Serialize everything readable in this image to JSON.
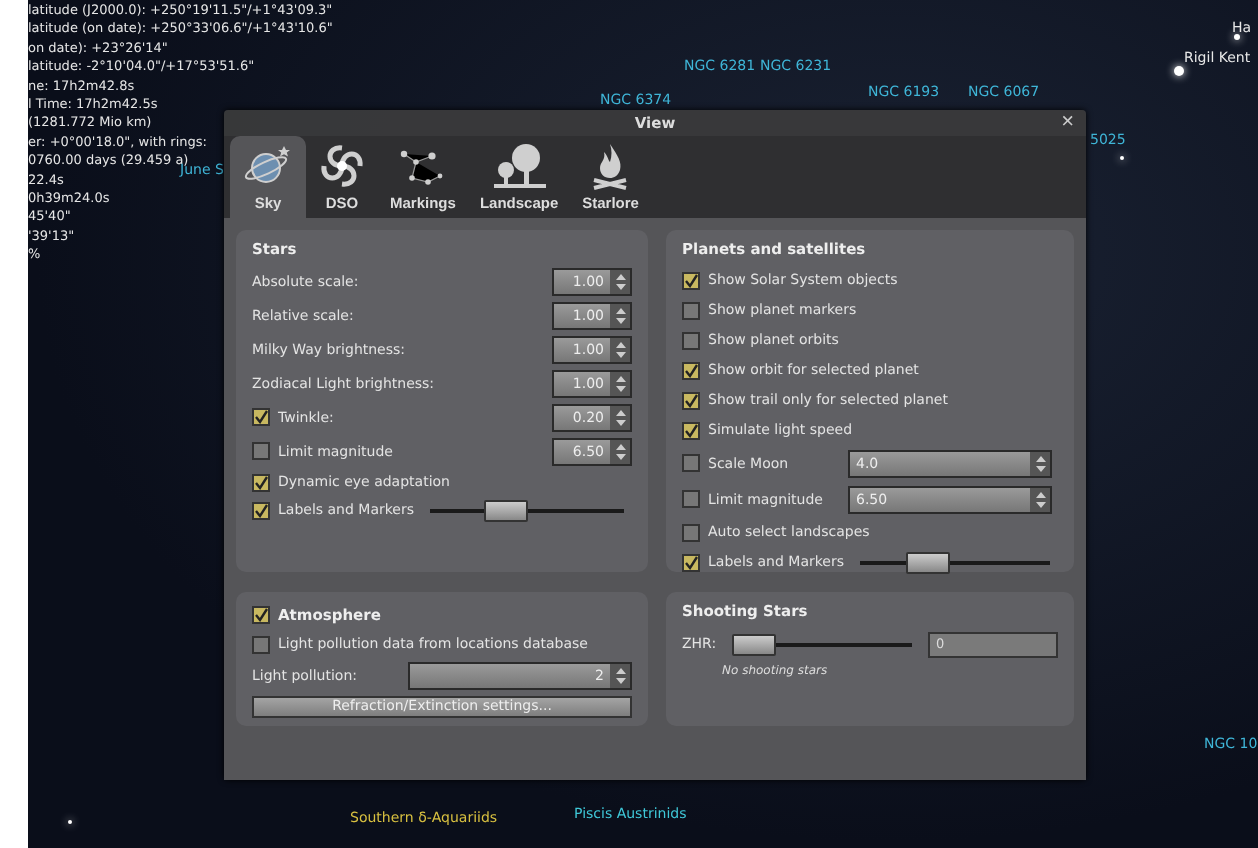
{
  "sky": {
    "info_lines": [
      "latitude (J2000.0): +250°19'11.5\"/+1°43'09.3\"",
      "latitude (on date): +250°33'06.6\"/+1°43'10.6\"",
      "on date): +23°26'14\"",
      "latitude: -2°10'04.0\"/+17°53'51.6\"",
      "ne: 17h2m42.8s",
      "l Time: 17h2m42.5s",
      "(1281.772 Mio km)",
      "er: +0°00'18.0\", with rings:",
      "0760.00 days (29.459 a)",
      "22.4s",
      "0h39m24.0s",
      "45'40\"",
      "'39'13\"",
      "%"
    ],
    "labels": [
      {
        "text": "NGC 6374",
        "color": "#3fb6d8"
      },
      {
        "text": "NGC 6281",
        "color": "#3fb6d8"
      },
      {
        "text": "NGC 6231",
        "color": "#3fb6d8"
      },
      {
        "text": "NGC 6193",
        "color": "#3fb6d8"
      },
      {
        "text": "NGC 6067",
        "color": "#3fb6d8"
      },
      {
        "text": "5025",
        "color": "#3fb6d8"
      },
      {
        "text": "Ha",
        "color": "#e8e8e8"
      },
      {
        "text": "Rigil Kent",
        "color": "#e8e8e8"
      },
      {
        "text": "June S",
        "color": "#3fb6d8"
      },
      {
        "text": "Southern δ-Aquariids",
        "color": "#d8c040"
      },
      {
        "text": "Piscis Austrinids",
        "color": "#3fc8d8"
      },
      {
        "text": "NGC 10",
        "color": "#3fb6d8"
      }
    ]
  },
  "window": {
    "title": "View",
    "close": "×"
  },
  "tabs": [
    {
      "label": "Sky",
      "selected": true
    },
    {
      "label": "DSO",
      "selected": false
    },
    {
      "label": "Markings",
      "selected": false
    },
    {
      "label": "Landscape",
      "selected": false
    },
    {
      "label": "Starlore",
      "selected": false
    }
  ],
  "stars": {
    "title": "Stars",
    "rows": [
      {
        "kind": "spin",
        "label": "Absolute scale:",
        "value": "1.00"
      },
      {
        "kind": "spin",
        "label": "Relative scale:",
        "value": "1.00"
      },
      {
        "kind": "spin",
        "label": "Milky Way brightness:",
        "value": "1.00"
      },
      {
        "kind": "spin",
        "label": "Zodiacal Light brightness:",
        "value": "1.00"
      },
      {
        "kind": "check-spin",
        "label": "Twinkle:",
        "checked": true,
        "value": "0.20"
      },
      {
        "kind": "check-spin",
        "label": "Limit magnitude",
        "checked": false,
        "value": "6.50"
      },
      {
        "kind": "check",
        "label": "Dynamic eye adaptation",
        "checked": true
      },
      {
        "kind": "check-slider",
        "label": "Labels and Markers",
        "checked": true,
        "level": 0.35
      }
    ]
  },
  "planets": {
    "title": "Planets and satellites",
    "rows": [
      {
        "kind": "check",
        "label": "Show Solar System objects",
        "checked": true
      },
      {
        "kind": "check",
        "label": "Show planet markers",
        "checked": false
      },
      {
        "kind": "check",
        "label": "Show planet orbits",
        "checked": false
      },
      {
        "kind": "check",
        "label": "Show orbit for selected planet",
        "checked": true
      },
      {
        "kind": "check",
        "label": "Show trail only for selected planet",
        "checked": true
      },
      {
        "kind": "check",
        "label": "Simulate light speed",
        "checked": true
      },
      {
        "kind": "check-field",
        "label": "Scale Moon",
        "checked": false,
        "value": "4.0"
      },
      {
        "kind": "check-field",
        "label": "Limit magnitude",
        "checked": false,
        "value": "6.50"
      },
      {
        "kind": "check",
        "label": "Auto select landscapes",
        "checked": false
      },
      {
        "kind": "check-slider",
        "label": "Labels and Markers",
        "checked": true,
        "level": 0.3
      }
    ]
  },
  "atmosphere": {
    "title": "Atmosphere",
    "checked": true,
    "rows": [
      {
        "kind": "check",
        "label": "Light pollution data from locations database",
        "checked": false
      },
      {
        "kind": "spin-wide",
        "label": "Light pollution:",
        "value": "2"
      },
      {
        "kind": "button",
        "label": "Refraction/Extinction settings..."
      }
    ]
  },
  "shooting_stars": {
    "title": "Shooting Stars",
    "label": "ZHR:",
    "level": 0,
    "value": "0",
    "note": "No shooting stars"
  }
}
